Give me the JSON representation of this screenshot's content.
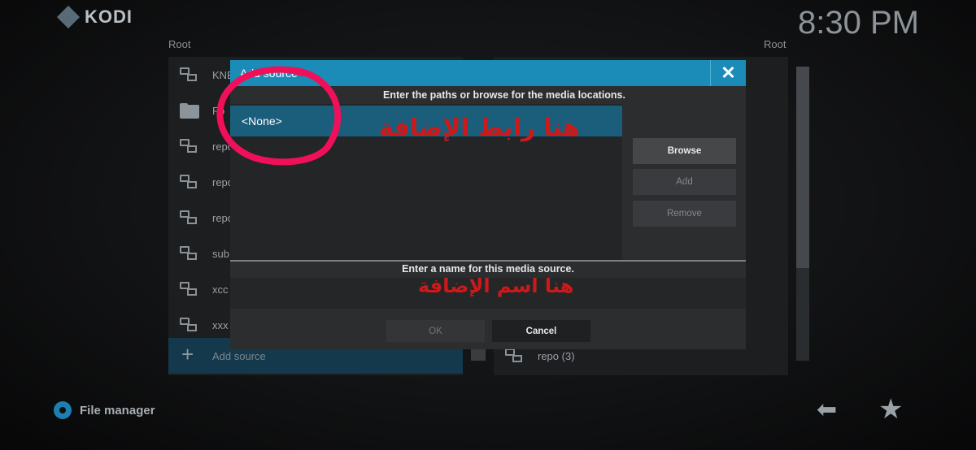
{
  "app": {
    "name": "KODI",
    "clock": "8:30 PM"
  },
  "left_panel": {
    "root_label": "Root",
    "items": [
      {
        "label": "KNE",
        "icon": "network-icon"
      },
      {
        "label": "Fo",
        "icon": "folder-icon"
      },
      {
        "label": "repo",
        "icon": "network-icon"
      },
      {
        "label": "repo",
        "icon": "network-icon"
      },
      {
        "label": "repo",
        "icon": "network-icon"
      },
      {
        "label": "sub",
        "icon": "network-icon"
      },
      {
        "label": "xcc",
        "icon": "network-icon"
      },
      {
        "label": "xxx",
        "icon": "network-icon"
      }
    ],
    "add_source_label": "Add source"
  },
  "right_panel": {
    "root_label": "Root",
    "bottom_item": "repo (3)"
  },
  "dialog": {
    "title": "Add source",
    "paths_prompt": "Enter the paths or browse for the media locations.",
    "path_value": "<None>",
    "browse_label": "Browse",
    "add_label": "Add",
    "remove_label": "Remove",
    "name_prompt": "Enter a name for this media source.",
    "name_value": "",
    "ok_label": "OK",
    "cancel_label": "Cancel"
  },
  "annotations": {
    "path_note": "هنا رابط الإضافة",
    "name_note": "هنا اسم الإضافة",
    "highlight_color": "#f0105a"
  },
  "footer": {
    "title": "File manager"
  },
  "colors": {
    "accent": "#1b8cb7",
    "selected": "#1a5e7c",
    "annotation": "#cc1a1a"
  }
}
